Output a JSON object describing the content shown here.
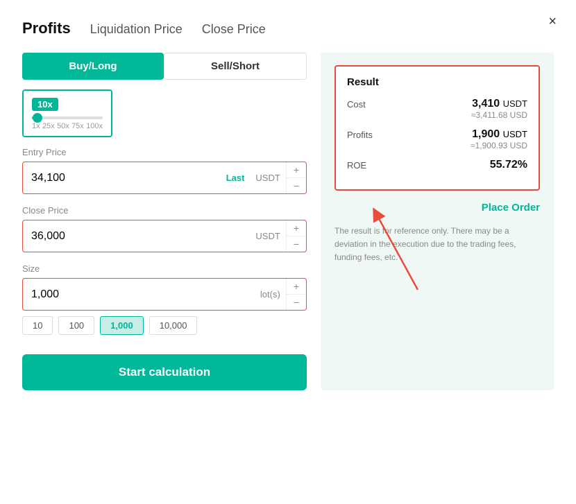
{
  "modal": {
    "close_label": "×"
  },
  "tabs": [
    {
      "label": "Profits",
      "active": true
    },
    {
      "label": "Liquidation Price",
      "active": false
    },
    {
      "label": "Close Price",
      "active": false
    }
  ],
  "toggle": {
    "buy_label": "Buy/Long",
    "sell_label": "Sell/Short"
  },
  "leverage": {
    "badge": "10x",
    "labels": [
      "1x",
      "25x",
      "50x",
      "75x",
      "100x"
    ]
  },
  "entry_price": {
    "label": "Entry Price",
    "value": "34,100",
    "unit_green": "Last",
    "unit": "USDT"
  },
  "close_price": {
    "label": "Close Price",
    "value": "36,000",
    "unit": "USDT"
  },
  "size": {
    "label": "Size",
    "value": "1,000",
    "unit": "lot(s)",
    "presets": [
      "10",
      "100",
      "1,000",
      "10,000"
    ]
  },
  "calc_button": "Start calculation",
  "result": {
    "title": "Result",
    "cost_label": "Cost",
    "cost_value": "3,410",
    "cost_unit": "USDT",
    "cost_usd": "≈3,411.68 USD",
    "profits_label": "Profits",
    "profits_value": "1,900",
    "profits_unit": "USDT",
    "profits_usd": "≈1,900.93 USD",
    "roe_label": "ROE",
    "roe_value": "55.72",
    "roe_unit": "%",
    "place_order": "Place Order"
  },
  "disclaimer": "The result is for reference only. There may be a deviation in the execution due to the trading fees, funding fees, etc."
}
